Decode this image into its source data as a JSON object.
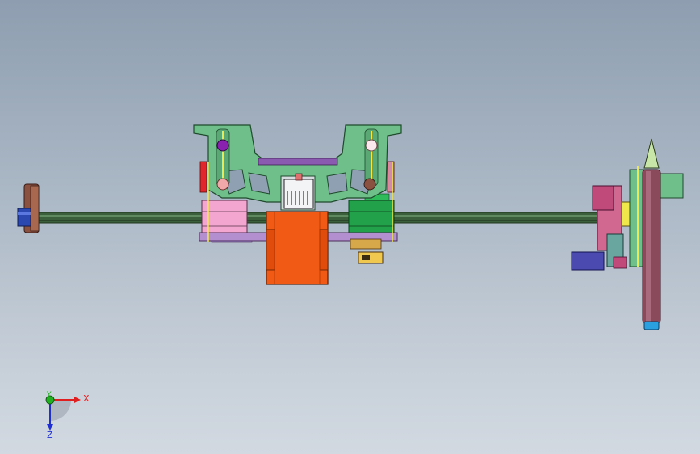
{
  "viewport": {
    "background_top": "#8e9eb0",
    "background_bottom": "#d2d9e1"
  },
  "triad": {
    "x_label": "X",
    "y_label": "Y",
    "z_label": "Z",
    "x_color": "#e02020",
    "y_color": "#22b022",
    "z_color": "#2030d0"
  },
  "model": {
    "rod_color": "#3b5e3b",
    "frame_color": "#6fbf8a",
    "motor_color": "#f15a14",
    "pen_color": "#8a4a5c",
    "pink_color": "#f0a0c8",
    "green_color": "#23a04a"
  }
}
